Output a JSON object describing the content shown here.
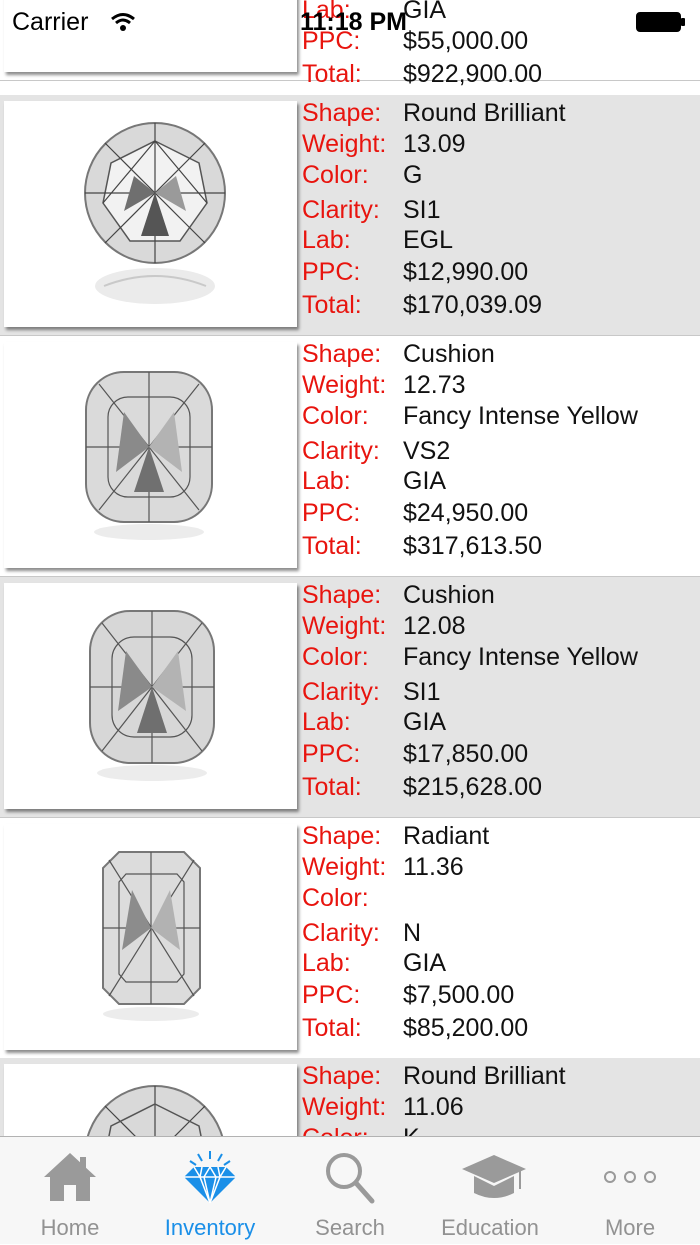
{
  "status_bar": {
    "carrier": "Carrier",
    "time": "11:18 PM"
  },
  "field_labels": {
    "shape": "Shape:",
    "weight": "Weight:",
    "color": "Color:",
    "clarity": "Clarity:",
    "lab": "Lab:",
    "ppc": "PPC:",
    "total": "Total:"
  },
  "diamonds": [
    {
      "shape": "",
      "weight": "",
      "color": "",
      "clarity": "",
      "lab": "GIA",
      "ppc": "$55,000.00",
      "total": "$922,900.00"
    },
    {
      "shape": "Round Brilliant",
      "weight": "13.09",
      "color": "G",
      "clarity": "SI1",
      "lab": "EGL",
      "ppc": "$12,990.00",
      "total": "$170,039.09"
    },
    {
      "shape": "Cushion",
      "weight": "12.73",
      "color": "Fancy Intense Yellow",
      "clarity": "VS2",
      "lab": "GIA",
      "ppc": "$24,950.00",
      "total": "$317,613.50"
    },
    {
      "shape": "Cushion",
      "weight": "12.08",
      "color": "Fancy Intense Yellow",
      "clarity": "SI1",
      "lab": "GIA",
      "ppc": "$17,850.00",
      "total": "$215,628.00"
    },
    {
      "shape": "Radiant",
      "weight": "11.36",
      "color": "",
      "clarity": "N",
      "lab": "GIA",
      "ppc": "$7,500.00",
      "total": "$85,200.00"
    },
    {
      "shape": "Round Brilliant",
      "weight": "11.06",
      "color": "K",
      "clarity": "",
      "lab": "",
      "ppc": "",
      "total": ""
    }
  ],
  "tab_bar": {
    "tabs": [
      {
        "label": "Home",
        "icon": "home-icon"
      },
      {
        "label": "Inventory",
        "icon": "diamond-icon",
        "selected": true
      },
      {
        "label": "Search",
        "icon": "search-icon"
      },
      {
        "label": "Education",
        "icon": "graduation-cap-icon"
      },
      {
        "label": "More",
        "icon": "more-icon"
      }
    ]
  },
  "colors": {
    "label_red": "#e8140e",
    "tab_active": "#1a8fe8",
    "tab_inactive": "#929292",
    "row_alt": "#e4e4e4"
  }
}
